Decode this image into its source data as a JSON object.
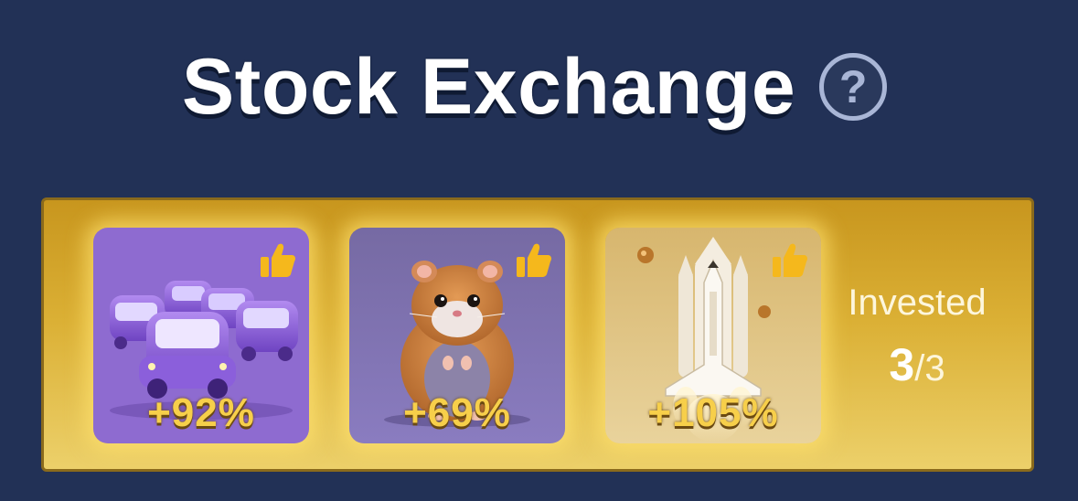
{
  "header": {
    "title": "Stock Exchange",
    "help_icon": "question-circle-icon",
    "help_symbol": "?"
  },
  "cards": [
    {
      "name": "purple-cars-card",
      "percent": "+92%",
      "icon": "thumbs-up-icon",
      "art": "purple-cars-image"
    },
    {
      "name": "hamster-card",
      "percent": "+69%",
      "icon": "thumbs-up-icon",
      "art": "hamster-image"
    },
    {
      "name": "space-shuttle-card",
      "percent": "+105%",
      "icon": "thumbs-up-icon",
      "art": "space-shuttle-image"
    }
  ],
  "invested": {
    "label": "Invested",
    "count": "3",
    "total": "/3"
  },
  "colors": {
    "background": "#223156",
    "panel_gold": "#dbb035",
    "percent_text": "#f7cf4a",
    "thumb_icon": "#f5b81c"
  }
}
